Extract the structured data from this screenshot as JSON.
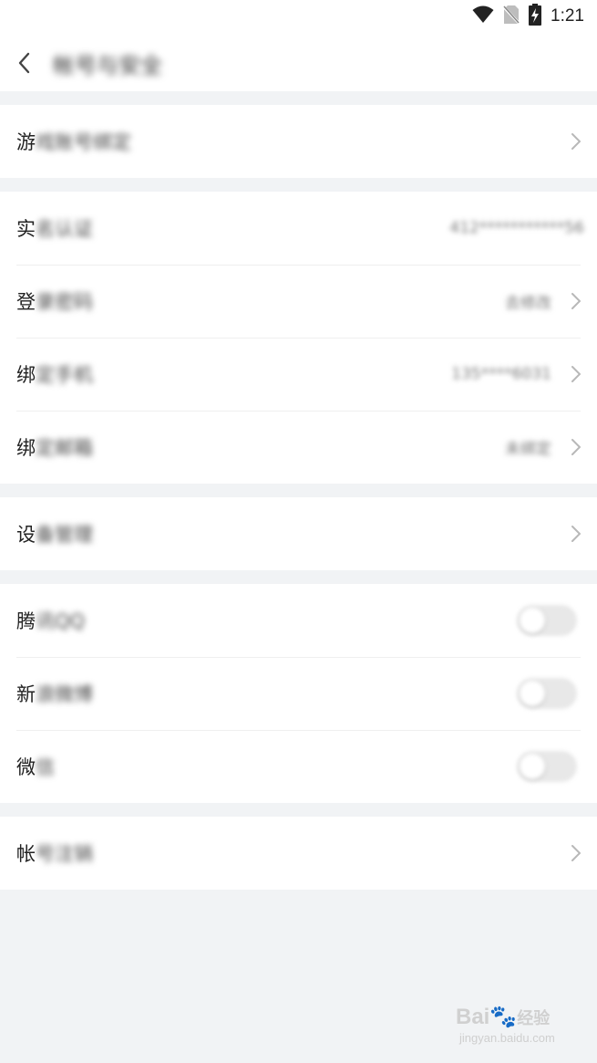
{
  "status_bar": {
    "time": "1:21",
    "icons": [
      "wifi-icon",
      "no-sim-icon",
      "battery-charging-icon"
    ]
  },
  "header": {
    "title": "帐号与安全",
    "back_icon": "chevron-left-icon"
  },
  "sections": [
    {
      "rows": [
        {
          "label_first": "游",
          "label_rest": "戏账号绑定",
          "type": "link"
        }
      ]
    },
    {
      "rows": [
        {
          "label_first": "实",
          "label_rest": "名认证",
          "type": "value",
          "value": "412***********56"
        },
        {
          "label_first": "登",
          "label_rest": "录密码",
          "type": "link",
          "value": "去修改"
        },
        {
          "label_first": "绑",
          "label_rest": "定手机",
          "type": "link",
          "value": "135****6031"
        },
        {
          "label_first": "绑",
          "label_rest": "定邮箱",
          "type": "link",
          "value": "未绑定"
        }
      ]
    },
    {
      "rows": [
        {
          "label_first": "设",
          "label_rest": "备管理",
          "type": "link"
        }
      ]
    },
    {
      "rows": [
        {
          "label_first": "腾",
          "label_rest": "讯QQ",
          "type": "toggle",
          "on": false
        },
        {
          "label_first": "新",
          "label_rest": "浪微博",
          "type": "toggle",
          "on": false
        },
        {
          "label_first": "微",
          "label_rest": "信",
          "type": "toggle",
          "on": false
        }
      ]
    },
    {
      "rows": [
        {
          "label_first": "帐",
          "label_rest": "号注销",
          "type": "link"
        }
      ]
    }
  ],
  "watermark": {
    "brand": "Bai",
    "brand_cn": "经验",
    "url": "jingyan.baidu.com"
  },
  "colors": {
    "background": "#f1f3f5",
    "surface": "#ffffff",
    "chevron": "#b8b8b8",
    "toggle_off": "#e8e8e8"
  }
}
